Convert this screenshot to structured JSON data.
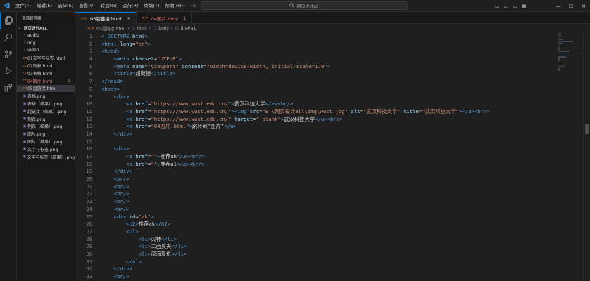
{
  "menu": [
    "文件(F)",
    "编辑(E)",
    "选择(S)",
    "查看(V)",
    "转到(G)",
    "运行(R)",
    "终端(T)",
    "帮助(H)"
  ],
  "command_center": "网页设计all",
  "sidebar": {
    "title": "资源管理器",
    "more": "···",
    "folder": "网页设计ALL",
    "items": [
      {
        "label": "audio",
        "type": "folder"
      },
      {
        "label": "img",
        "type": "folder"
      },
      {
        "label": "video",
        "type": "folder"
      },
      {
        "label": "01文字与标签.html",
        "type": "html"
      },
      {
        "label": "02列表.html",
        "type": "html"
      },
      {
        "label": "03表格.html",
        "type": "html"
      },
      {
        "label": "04图片.html",
        "type": "html",
        "badge": "1",
        "error": true
      },
      {
        "label": "05超链接.html",
        "type": "html",
        "selected": true
      },
      {
        "label": "表格.png",
        "type": "png"
      },
      {
        "label": "表格（结果）.png",
        "type": "png"
      },
      {
        "label": "超链接（结果）.png",
        "type": "png"
      },
      {
        "label": "列表.png",
        "type": "png"
      },
      {
        "label": "列表（结果）.png",
        "type": "png"
      },
      {
        "label": "图片.png",
        "type": "png"
      },
      {
        "label": "图片（结果）.png",
        "type": "png"
      },
      {
        "label": "文字与标签.png",
        "type": "png"
      },
      {
        "label": "文字与标签（结果）.png",
        "type": "png"
      }
    ]
  },
  "tabs": [
    {
      "label": "05超链接.html",
      "active": true
    },
    {
      "label": "04图片.html",
      "badge": "1"
    }
  ],
  "breadcrumb": [
    "05超链接.html",
    "html",
    "body",
    "div#a1"
  ],
  "code_lines": [
    [
      [
        "tag",
        "<!DOCTYPE "
      ],
      [
        "attr",
        "html"
      ],
      [
        "tag",
        ">"
      ]
    ],
    [
      [
        "tag",
        "<html "
      ],
      [
        "attr",
        "lang"
      ],
      [
        "txt",
        "="
      ],
      [
        "str",
        "\"en\""
      ],
      [
        "tag",
        ">"
      ]
    ],
    [
      [
        "tag",
        "<head>"
      ]
    ],
    [
      [
        "ind",
        "    "
      ],
      [
        "tag",
        "<meta "
      ],
      [
        "attr",
        "charset"
      ],
      [
        "txt",
        "="
      ],
      [
        "str",
        "\"UTF-8\""
      ],
      [
        "tag",
        ">"
      ]
    ],
    [
      [
        "ind",
        "    "
      ],
      [
        "tag",
        "<meta "
      ],
      [
        "attr",
        "name"
      ],
      [
        "txt",
        "="
      ],
      [
        "str",
        "\"viewport\""
      ],
      [
        "txt",
        " "
      ],
      [
        "attr",
        "content"
      ],
      [
        "txt",
        "="
      ],
      [
        "str",
        "\"width=device-width, initial-scale=1.0\""
      ],
      [
        "tag",
        ">"
      ]
    ],
    [
      [
        "ind",
        "    "
      ],
      [
        "tag",
        "<title>"
      ],
      [
        "txt",
        "超链接"
      ],
      [
        "tag",
        "</title>"
      ]
    ],
    [
      [
        "tag",
        "</head>"
      ]
    ],
    [
      [
        "tag",
        "<body>"
      ]
    ],
    [
      [
        "ind",
        "    "
      ],
      [
        "tag",
        "<div>"
      ]
    ],
    [
      [
        "ind",
        "        "
      ],
      [
        "tag",
        "<a "
      ],
      [
        "attr",
        "href"
      ],
      [
        "txt",
        "="
      ],
      [
        "str",
        "\"https://www.wust.edu.cn/\""
      ],
      [
        "tag",
        ">"
      ],
      [
        "txt",
        "武汉科技大学"
      ],
      [
        "tag",
        "</a><br/>"
      ]
    ],
    [
      [
        "ind",
        "        "
      ],
      [
        "tag",
        "<a "
      ],
      [
        "attr",
        "href"
      ],
      [
        "txt",
        "="
      ],
      [
        "str",
        "\"https://www.wust.edu.cn/\""
      ],
      [
        "tag",
        "><img "
      ],
      [
        "attr",
        "src"
      ],
      [
        "txt",
        "="
      ],
      [
        "str",
        "\"E:\\网页设计all\\img\\wust.jpg\""
      ],
      [
        "txt",
        " "
      ],
      [
        "attr",
        "alt"
      ],
      [
        "txt",
        "="
      ],
      [
        "str",
        "\"武汉科技大学\""
      ],
      [
        "txt",
        " "
      ],
      [
        "attr",
        "title"
      ],
      [
        "txt",
        "="
      ],
      [
        "str",
        "\"武汉科技大学\""
      ],
      [
        "tag",
        "></a><br/>"
      ]
    ],
    [
      [
        "ind",
        "        "
      ],
      [
        "tag",
        "<a "
      ],
      [
        "attr",
        "href"
      ],
      [
        "txt",
        "="
      ],
      [
        "str",
        "\"https://www.wust.edu.cn/\""
      ],
      [
        "txt",
        " "
      ],
      [
        "attr",
        "target"
      ],
      [
        "txt",
        "="
      ],
      [
        "str",
        "\"_blank\""
      ],
      [
        "tag",
        ">"
      ],
      [
        "txt",
        "武汉科技大学"
      ],
      [
        "tag",
        "</a><br/>"
      ]
    ],
    [
      [
        "ind",
        "        "
      ],
      [
        "tag",
        "<a "
      ],
      [
        "attr",
        "href"
      ],
      [
        "txt",
        "="
      ],
      [
        "str",
        "\"04图片.html\""
      ],
      [
        "tag",
        ">"
      ],
      [
        "txt",
        "跳转到“图片”"
      ],
      [
        "tag",
        "</a>"
      ]
    ],
    [
      [
        "ind",
        "    "
      ],
      [
        "tag",
        "</div>"
      ]
    ],
    [],
    [
      [
        "ind",
        "    "
      ],
      [
        "tag",
        "<div>"
      ]
    ],
    [
      [
        "ind",
        "        "
      ],
      [
        "tag",
        "<a "
      ],
      [
        "attr",
        "href"
      ],
      [
        "txt",
        "="
      ],
      [
        "str",
        "\"\""
      ],
      [
        "tag",
        ">"
      ],
      [
        "txt",
        "推荐ak"
      ],
      [
        "tag",
        "</a><br/>"
      ]
    ],
    [
      [
        "ind",
        "        "
      ],
      [
        "tag",
        "<a "
      ],
      [
        "attr",
        "href"
      ],
      [
        "txt",
        "="
      ],
      [
        "str",
        "\"\""
      ],
      [
        "tag",
        ">"
      ],
      [
        "txt",
        "推荐a1"
      ],
      [
        "tag",
        "</a><br/>"
      ]
    ],
    [
      [
        "ind",
        "    "
      ],
      [
        "tag",
        "</div>"
      ]
    ],
    [
      [
        "ind",
        "    "
      ],
      [
        "tag",
        "<br/>"
      ]
    ],
    [
      [
        "ind",
        "    "
      ],
      [
        "tag",
        "<br/>"
      ]
    ],
    [
      [
        "ind",
        "    "
      ],
      [
        "tag",
        "<br/>"
      ]
    ],
    [
      [
        "ind",
        "    "
      ],
      [
        "tag",
        "<br/>"
      ]
    ],
    [
      [
        "ind",
        "    "
      ],
      [
        "tag",
        "<br/>"
      ]
    ],
    [
      [
        "ind",
        "    "
      ],
      [
        "tag",
        "<div "
      ],
      [
        "attr",
        "id"
      ],
      [
        "txt",
        "="
      ],
      [
        "str",
        "\"ak\""
      ],
      [
        "tag",
        ">"
      ]
    ],
    [
      [
        "ind",
        "        "
      ],
      [
        "tag",
        "<h2>"
      ],
      [
        "txt",
        "推荐ak"
      ],
      [
        "tag",
        "</h2>"
      ]
    ],
    [
      [
        "ind",
        "        "
      ],
      [
        "tag",
        "<ul>"
      ]
    ],
    [
      [
        "ind",
        "            "
      ],
      [
        "tag",
        "<li>"
      ],
      [
        "txt",
        "火神"
      ],
      [
        "tag",
        "</li>"
      ]
    ],
    [
      [
        "ind",
        "            "
      ],
      [
        "tag",
        "<li>"
      ],
      [
        "txt",
        "二西莫夫"
      ],
      [
        "tag",
        "</li>"
      ]
    ],
    [
      [
        "ind",
        "            "
      ],
      [
        "tag",
        "<li>"
      ],
      [
        "txt",
        "深海复仇"
      ],
      [
        "tag",
        "</li>"
      ]
    ],
    [
      [
        "ind",
        "        "
      ],
      [
        "tag",
        "</ul>"
      ]
    ],
    [
      [
        "ind",
        "    "
      ],
      [
        "tag",
        "</div>"
      ]
    ],
    [
      [
        "ind",
        "    "
      ],
      [
        "tag",
        "<br/>"
      ]
    ]
  ]
}
